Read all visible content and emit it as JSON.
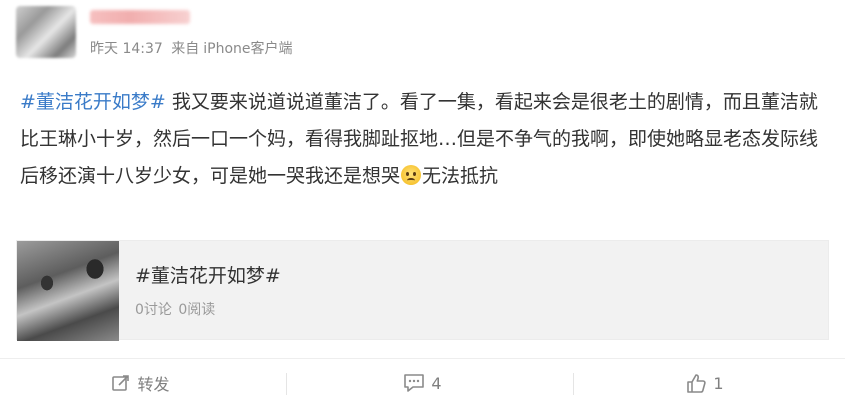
{
  "post": {
    "meta": {
      "time": "昨天 14:37",
      "source_prefix": "来自",
      "source": "iPhone客户端"
    },
    "hashtag": "#董洁花开如梦#",
    "text": " 我又要来说道说道董洁了。看了一集，看起来会是很老土的剧情，而且董洁就比王琳小十岁，然后一口一个妈，看得我脚趾抠地…但是不争气的我啊，即使她略显老态发际线后移还演十八岁少女，可是她一哭我还是想哭",
    "text_after_emoji": "无法抵抗",
    "emoji": "crying-face-emoji"
  },
  "topic_card": {
    "title": "#董洁花开如梦#",
    "discussions": "0讨论",
    "reads": "0阅读"
  },
  "actions": {
    "repost_label": "转发",
    "comment_count": "4",
    "like_count": "1",
    "icons": [
      "repost-icon",
      "comment-icon",
      "like-icon"
    ]
  },
  "colors": {
    "link": "#3a7bc8",
    "text": "#333333",
    "meta": "#8a8a8a",
    "card_bg": "#f2f2f2"
  }
}
